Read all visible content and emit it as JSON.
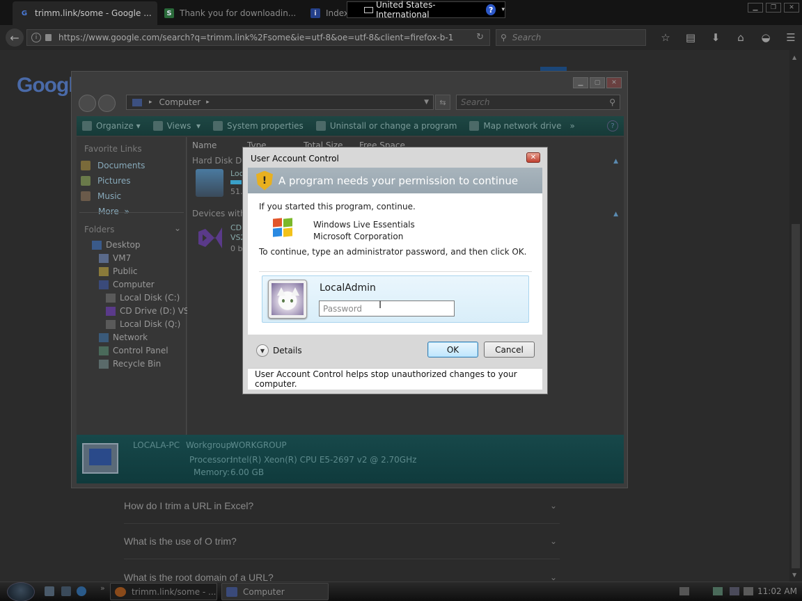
{
  "browser": {
    "tabs": [
      {
        "title": "trimm.link/some - Google ...",
        "favicon": "G",
        "active": true
      },
      {
        "title": "Thank you for downloadin...",
        "favicon": "S",
        "active": false
      },
      {
        "title": "Index",
        "favicon": "i",
        "active": false
      }
    ],
    "tab_close": "✕",
    "url": "https://www.google.com/search?q=trimm.link%2Fsome&ie=utf-8&oe=utf-8&client=firefox-b-1",
    "search_placeholder": "Search",
    "language_bar": "United States-International",
    "language_help": "?"
  },
  "google": {
    "logo": "Googl",
    "faq": [
      "How do I trim a URL in Excel?",
      "What is the use of O trim?",
      "What is the root domain of a URL?"
    ]
  },
  "explorer": {
    "address": "Computer",
    "search_placeholder": "Search",
    "commands": [
      "Organize",
      "Views",
      "System properties",
      "Uninstall or change a program",
      "Map network drive"
    ],
    "more_commands": "»",
    "help": "?",
    "favorite_links_header": "Favorite Links",
    "favorite_links": [
      "Documents",
      "Pictures",
      "Music"
    ],
    "more_label": "More",
    "more_arrows": "»",
    "folders_header": "Folders",
    "tree": [
      "Desktop",
      "VM7",
      "Public",
      "Computer",
      "Local Disk (C:)",
      "CD Drive (D:) VS20",
      "Local Disk (Q:)",
      "Network",
      "Control Panel",
      "Recycle Bin"
    ],
    "columns": [
      "Name",
      "Type",
      "Total Size",
      "Free Space"
    ],
    "group_hard_disk": "Hard Disk Dr",
    "group_devices": "Devices with",
    "drive_c_label": "Loc",
    "drive_c_size": "51.",
    "drive_d_label": "CD",
    "drive_d_label2": "VS2",
    "drive_d_size": "0 b",
    "details": {
      "computer_name": "LOCALA-PC",
      "workgroup_label": "Workgroup:",
      "workgroup_value": "WORKGROUP",
      "processor_label": "Processor:",
      "processor_value": "Intel(R) Xeon(R) CPU E5-2697 v2 @ 2.70GHz",
      "memory_label": "Memory:",
      "memory_value": "6.00 GB"
    }
  },
  "uac": {
    "title": "User Account Control",
    "close": "✕",
    "headline": "A program needs your permission to continue",
    "intro": "If you started this program, continue.",
    "program_name": "Windows Live Essentials",
    "publisher": "Microsoft Corporation",
    "instruction": "To continue, type an administrator password, and then click OK.",
    "username": "LocalAdmin",
    "password_placeholder": "Password",
    "details_label": "Details",
    "ok_label": "OK",
    "cancel_label": "Cancel",
    "footer": "User Account Control helps stop unauthorized changes to your computer."
  },
  "taskbar": {
    "more": "»",
    "buttons": [
      {
        "label": "trimm.link/some - ...",
        "active": false
      },
      {
        "label": "Computer",
        "active": true
      }
    ],
    "clock": "11:02 AM"
  }
}
